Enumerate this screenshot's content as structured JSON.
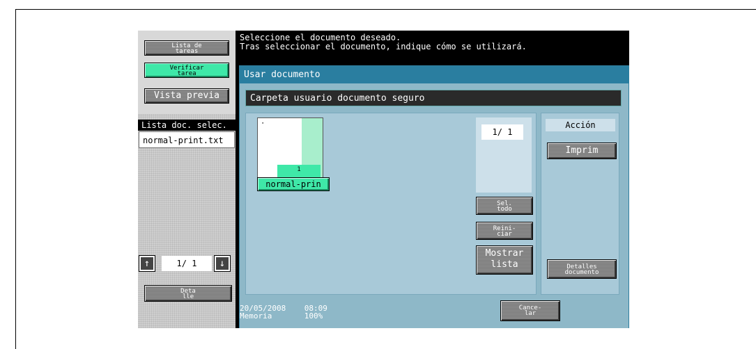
{
  "header": {
    "message_line1": "Seleccione el documento deseado.",
    "message_line2": "Tras seleccionar el documento, indique cómo se utilizará."
  },
  "left_panel": {
    "lista_tareas": "Lista de tareas",
    "verificar_tarea": "Verificar tarea",
    "vista_previa": "Vista previa",
    "lista_doc_header": "Lista doc. selec.",
    "lista_doc_item": "normal-print.txt",
    "page_indicator": "1/ 1",
    "detalle": "Deta lle"
  },
  "main": {
    "title": "Usar documento",
    "folder": "Carpeta usuario documento seguro",
    "thumbnail_page": "1",
    "thumbnail_label": "normal-prin",
    "page_indicator": "1/ 1",
    "sel_todo": "Sel. todo",
    "reiniciar": "Reini- ciar",
    "mostrar_lista": "Mostrar lista"
  },
  "action": {
    "header": "Acción",
    "imprim": "Imprim",
    "detalles_documento": "Detalles documento"
  },
  "footer": {
    "date": "20/05/2008",
    "time": "08:09",
    "memory_label": "Memoria",
    "memory_value": "100%",
    "cancelar": "Cance- lar"
  },
  "colors": {
    "accent_green": "#3fe8a8",
    "title_teal": "#2a7ea0",
    "panel_bg": "#8eb8c8"
  }
}
